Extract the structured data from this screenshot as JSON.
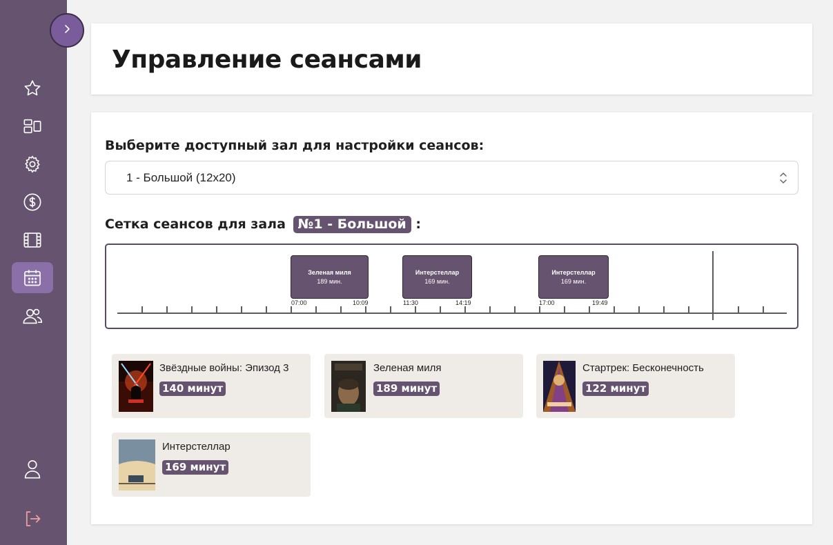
{
  "page": {
    "title": "Управление сеансами"
  },
  "sidebar": {
    "items": [
      {
        "icon": "star-icon"
      },
      {
        "icon": "halls-layout-icon"
      },
      {
        "icon": "gear-icon"
      },
      {
        "icon": "dollar-icon"
      },
      {
        "icon": "film-icon"
      },
      {
        "icon": "calendar-icon",
        "active": true
      },
      {
        "icon": "users-icon"
      }
    ],
    "bottom": [
      {
        "icon": "user-icon"
      },
      {
        "icon": "logout-icon"
      }
    ]
  },
  "hall_select": {
    "label": "Выберите доступный зал для настройки сеансов:",
    "value": "1 - Большой (12x20)"
  },
  "grid": {
    "label_prefix": "Сетка сеансов для зала",
    "hall_badge": "№1 - Большой",
    "label_suffix": ":",
    "sessions": [
      {
        "title": "Зеленая миля",
        "duration": "189 мин.",
        "start": "07:00",
        "end": "10:09"
      },
      {
        "title": "Интерстеллар",
        "duration": "169 мин.",
        "start": "11:30",
        "end": "14:19"
      },
      {
        "title": "Интерстеллар",
        "duration": "169 мин.",
        "start": "17:00",
        "end": "19:49"
      }
    ]
  },
  "movies": [
    {
      "title": "Звёздные войны: Эпизод 3",
      "duration": "140 минут"
    },
    {
      "title": "Зеленая миля",
      "duration": "189 минут"
    },
    {
      "title": "Стартрек: Бесконечность",
      "duration": "122 минут"
    },
    {
      "title": "Интерстеллар",
      "duration": "169 минут"
    }
  ],
  "colors": {
    "sidebar": "#66536f",
    "accent": "#66536f",
    "active_nav": "#8b6fa8",
    "movie_card": "#efebe6"
  }
}
